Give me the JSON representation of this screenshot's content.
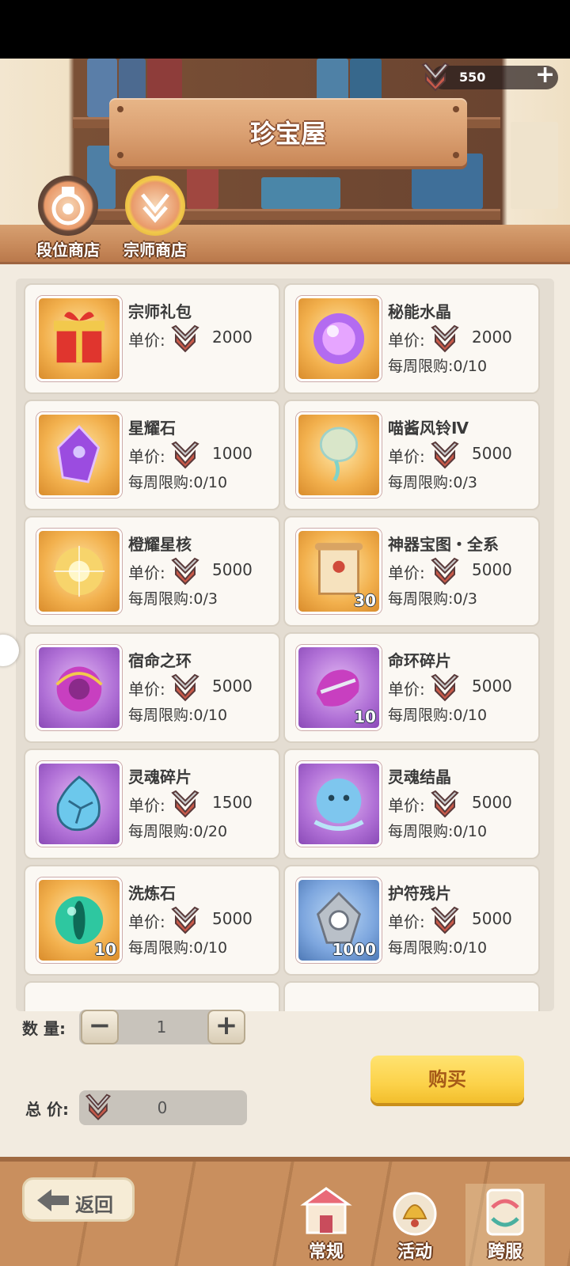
{
  "header": {
    "title": "珍宝屋",
    "currency": {
      "value": "550",
      "plus": "+",
      "icon": "crossed-swords-badge-icon"
    },
    "shop_tabs": [
      {
        "label": "段位商店",
        "icon": "rank-medal-icon"
      },
      {
        "label": "宗师商店",
        "icon": "master-badge-icon"
      }
    ]
  },
  "items": [
    {
      "name": "宗师礼包",
      "price_label": "单价:",
      "price": "2000",
      "limit": "",
      "icon": "gift-box-icon",
      "frame": "gold",
      "qty": ""
    },
    {
      "name": "秘能水晶",
      "price_label": "单价:",
      "price": "2000",
      "limit": "每周限购:0/10",
      "icon": "purple-orb-icon",
      "frame": "gold",
      "qty": ""
    },
    {
      "name": "星耀石",
      "price_label": "单价:",
      "price": "1000",
      "limit": "每周限购:0/10",
      "icon": "purple-crystal-icon",
      "frame": "gold",
      "qty": ""
    },
    {
      "name": "喵酱风铃Ⅳ",
      "price_label": "单价:",
      "price": "5000",
      "limit": "每周限购:0/3",
      "icon": "wind-chime-icon",
      "frame": "gold",
      "qty": ""
    },
    {
      "name": "橙耀星核",
      "price_label": "单价:",
      "price": "5000",
      "limit": "每周限购:0/3",
      "icon": "star-core-icon",
      "frame": "gold",
      "qty": ""
    },
    {
      "name": "神器宝图・全系",
      "price_label": "单价:",
      "price": "5000",
      "limit": "每周限购:0/3",
      "icon": "scroll-map-icon",
      "frame": "gold",
      "qty": "30"
    },
    {
      "name": "宿命之环",
      "price_label": "单价:",
      "price": "5000",
      "limit": "每周限购:0/10",
      "icon": "fate-ring-icon",
      "frame": "purple",
      "qty": ""
    },
    {
      "name": "命环碎片",
      "price_label": "单价:",
      "price": "5000",
      "limit": "每周限购:0/10",
      "icon": "ring-fragment-icon",
      "frame": "purple",
      "qty": "10"
    },
    {
      "name": "灵魂碎片",
      "price_label": "单价:",
      "price": "1500",
      "limit": "每周限购:0/20",
      "icon": "soul-shard-icon",
      "frame": "purple",
      "qty": ""
    },
    {
      "name": "灵魂结晶",
      "price_label": "单价:",
      "price": "5000",
      "limit": "每周限购:0/10",
      "icon": "soul-crystal-icon",
      "frame": "purple",
      "qty": ""
    },
    {
      "name": "洗炼石",
      "price_label": "单价:",
      "price": "5000",
      "limit": "每周限购:0/10",
      "icon": "green-orb-icon",
      "frame": "gold",
      "qty": "10"
    },
    {
      "name": "护符残片",
      "price_label": "单价:",
      "price": "5000",
      "limit": "每周限购:0/10",
      "icon": "amulet-shard-icon",
      "frame": "blue",
      "qty": "1000"
    }
  ],
  "purchase": {
    "qty_label": "数 量:",
    "qty_value": "1",
    "minus": "−",
    "plus": "+",
    "total_label": "总 价:",
    "total_value": "0",
    "buy_label": "购买"
  },
  "bottom_nav": {
    "back_label": "返回",
    "tabs": [
      {
        "label": "常规",
        "icon": "shop-stall-icon"
      },
      {
        "label": "活动",
        "icon": "event-bell-icon"
      },
      {
        "label": "跨服",
        "icon": "cross-server-icon"
      }
    ]
  },
  "colors": {
    "accent_gold": "#fcd24a",
    "wood": "#c98f5e",
    "panel_bg": "#f2ebe0"
  }
}
